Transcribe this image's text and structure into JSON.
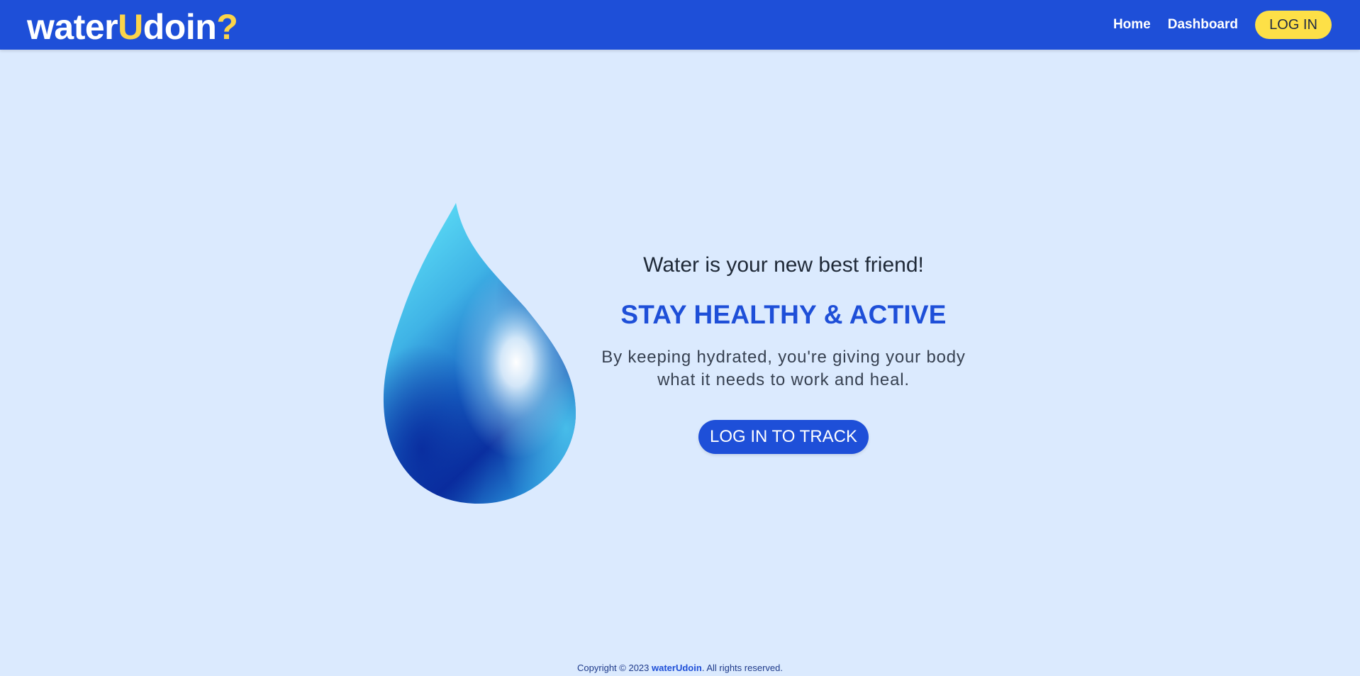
{
  "brand": {
    "name_part1": "water",
    "name_part2": "U",
    "name_part3": "doin",
    "name_part4": "?",
    "primary_color": "#1e4fd8",
    "accent_color": "#fde047"
  },
  "nav": {
    "home": "Home",
    "dashboard": "Dashboard",
    "login": "LOG IN"
  },
  "hero": {
    "tagline": "Water is your new best friend!",
    "headline": "STAY HEALTHY & ACTIVE",
    "subtext_line1": "By keeping hydrated, you're giving your body",
    "subtext_line2": "what it needs to work and heal.",
    "cta": "LOG IN TO TRACK",
    "illustration": "water-drop-icon"
  },
  "footer": {
    "prefix": "Copyright © 2023 ",
    "brand": "waterUdoin",
    "suffix": ". All rights reserved."
  }
}
